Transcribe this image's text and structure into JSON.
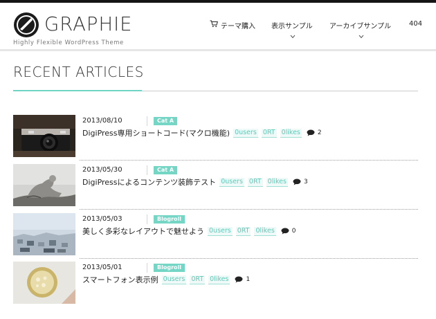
{
  "site": {
    "name": "GRAPHIE",
    "tagline": "Highly Flexible WordPress Theme"
  },
  "nav": {
    "items": [
      {
        "label": "テーマ購入",
        "icon": "cart-icon"
      },
      {
        "label": "表示サンプル",
        "icon": "chevron-down-icon"
      },
      {
        "label": "アーカイブサンプル",
        "icon": "chevron-down-icon"
      },
      {
        "label": "404"
      }
    ]
  },
  "section": {
    "title": "RECENT ARTICLES"
  },
  "articles": [
    {
      "date": "2013/08/10",
      "category": "Cat A",
      "title": "DigiPress専用ショートコード(マクロ機能)",
      "users": "0users",
      "rt": "0RT",
      "likes": "0likes",
      "comments": "2",
      "thumb": "camera"
    },
    {
      "date": "2013/05/30",
      "category": "Cat A",
      "title": "DigiPressによるコンテンツ装飾テスト",
      "users": "0users",
      "rt": "0RT",
      "likes": "0likes",
      "comments": "3",
      "thumb": "statue"
    },
    {
      "date": "2013/05/03",
      "category": "Blogroll",
      "title": "美しく多彩なレイアウトで魅せよう",
      "users": "0users",
      "rt": "0RT",
      "likes": "0likes",
      "comments": "0",
      "thumb": "city"
    },
    {
      "date": "2013/05/01",
      "category": "Blogroll",
      "title": "スマートフォン表示例",
      "users": "0users",
      "rt": "0RT",
      "likes": "0likes",
      "comments": "1",
      "thumb": "cup"
    }
  ],
  "colors": {
    "accent": "#75d6c5",
    "topbar": "#151515"
  }
}
